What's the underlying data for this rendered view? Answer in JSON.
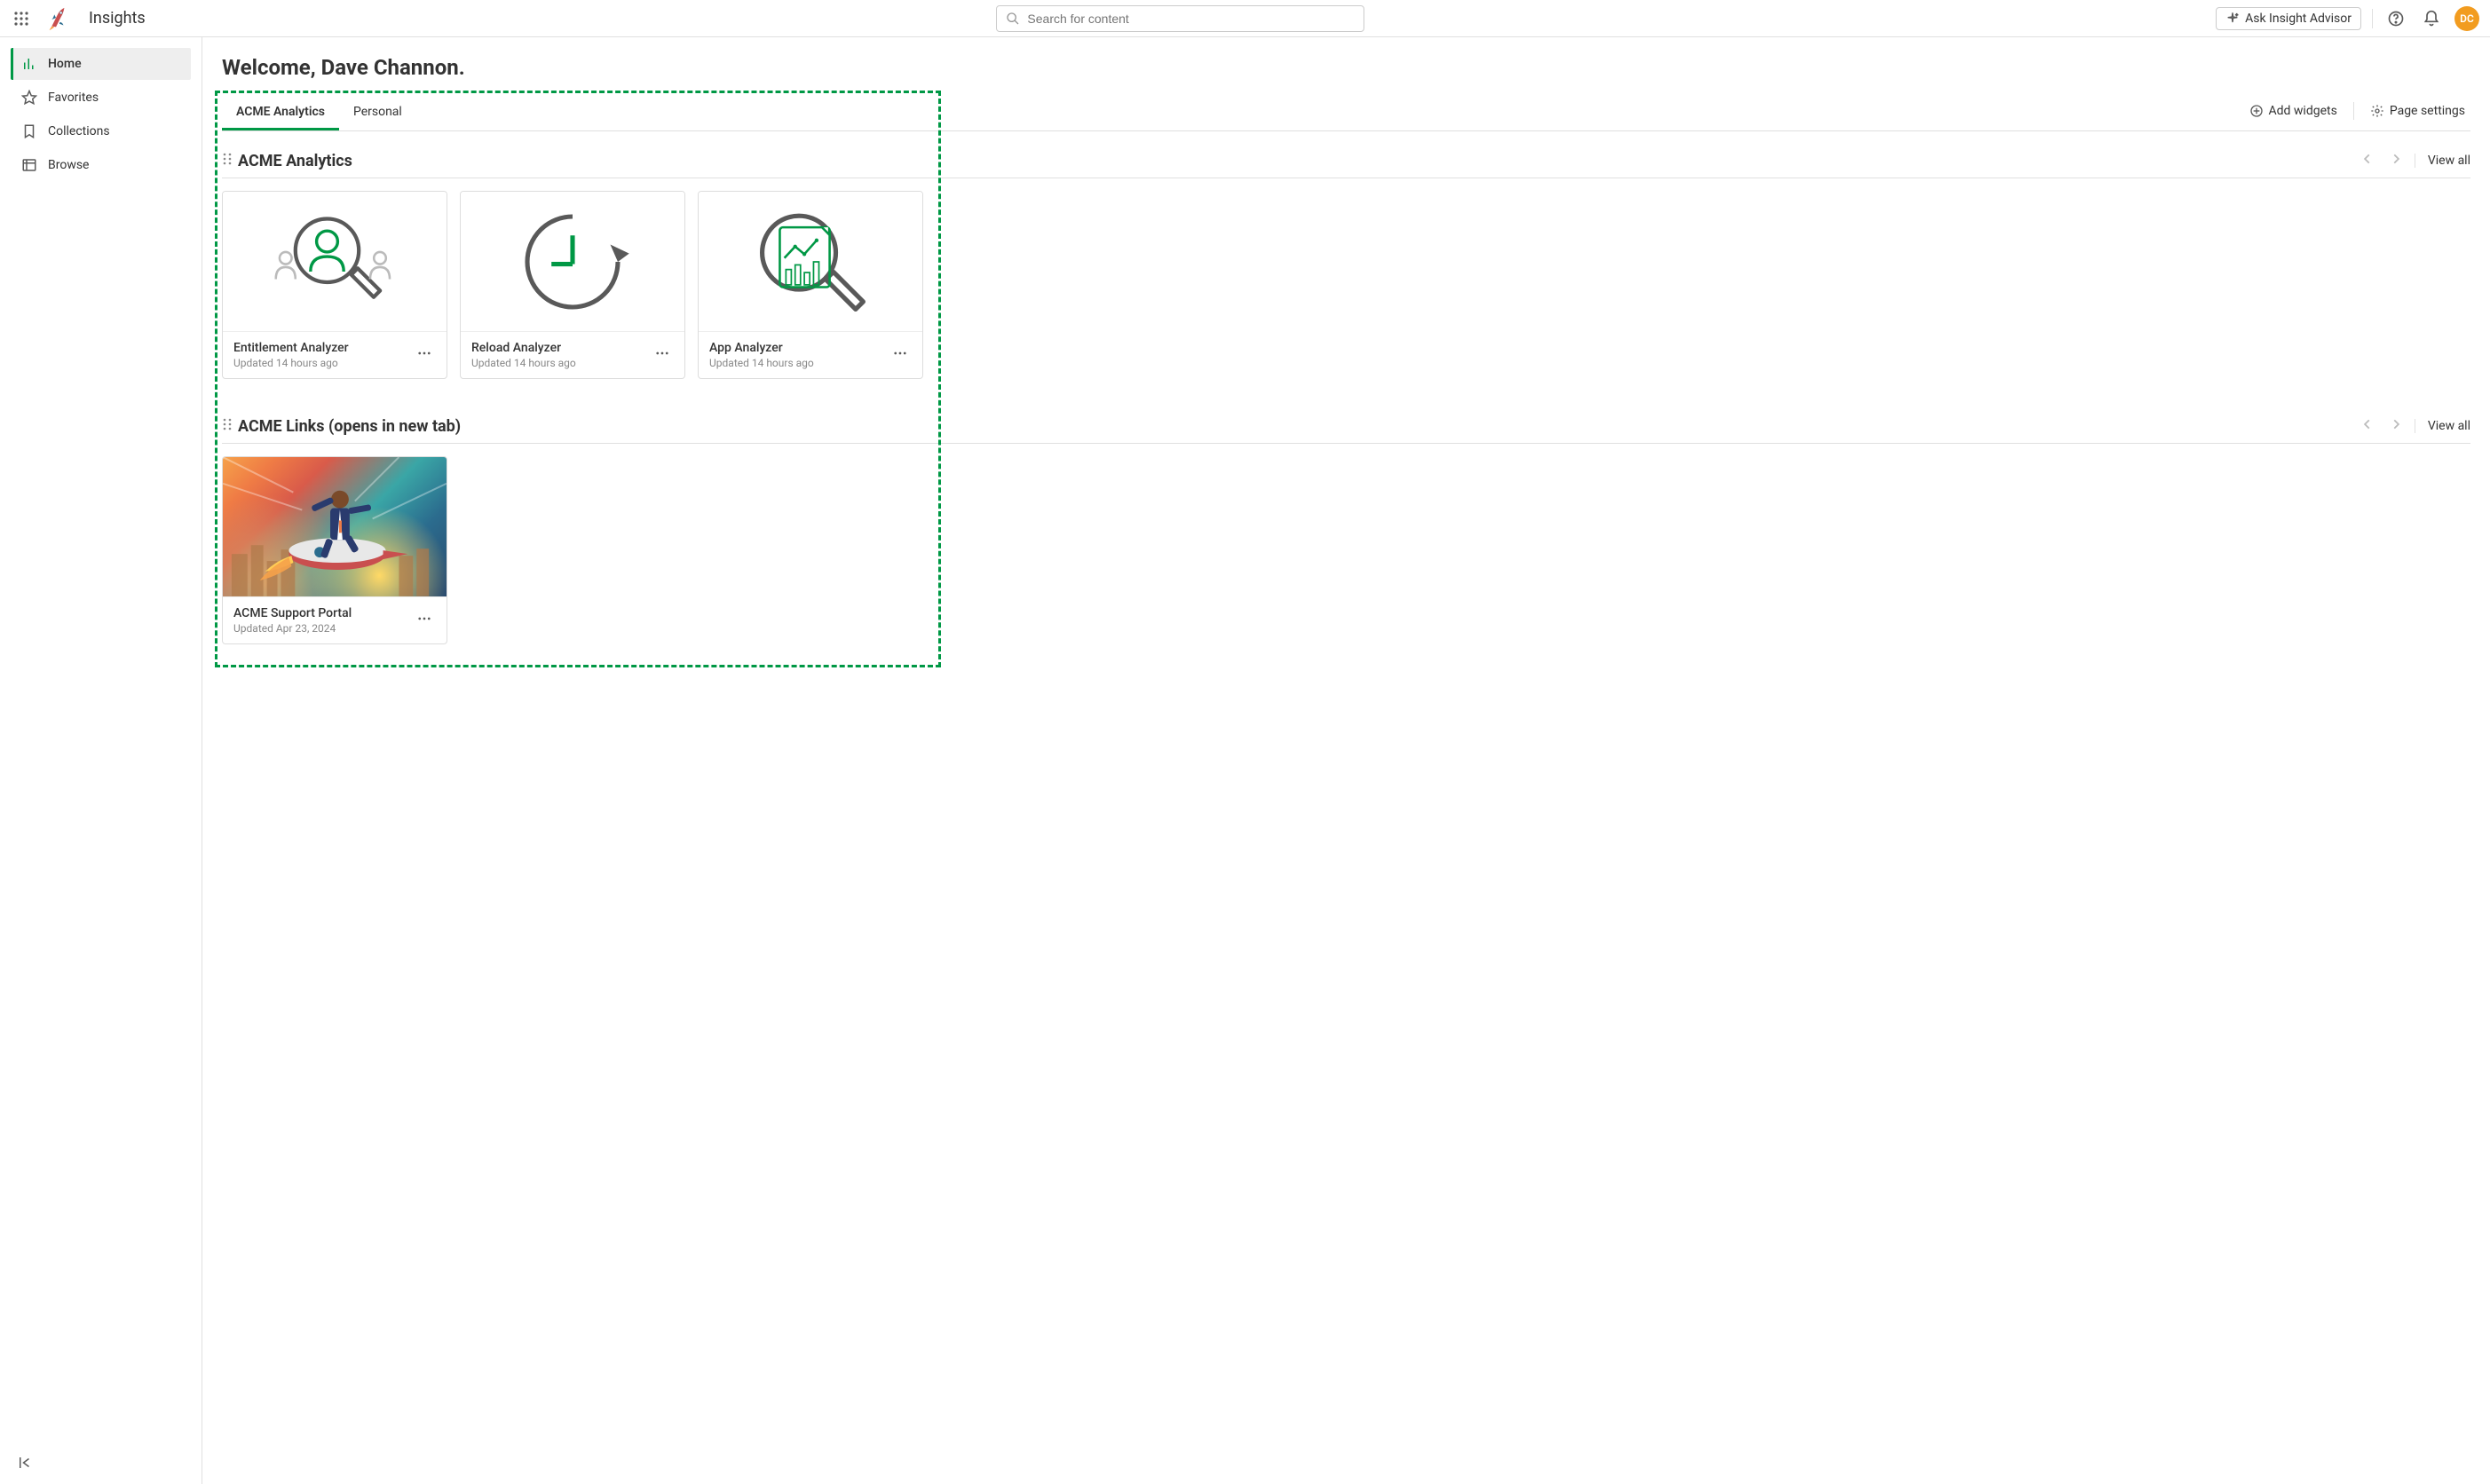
{
  "app": {
    "title": "Insights"
  },
  "search": {
    "placeholder": "Search for content"
  },
  "ask": {
    "label": "Ask Insight Advisor"
  },
  "avatar": {
    "initials": "DC"
  },
  "sidebar": {
    "items": [
      {
        "label": "Home"
      },
      {
        "label": "Favorites"
      },
      {
        "label": "Collections"
      },
      {
        "label": "Browse"
      }
    ]
  },
  "welcome": "Welcome, Dave Channon.",
  "tabs": {
    "items": [
      {
        "label": "ACME Analytics"
      },
      {
        "label": "Personal"
      }
    ]
  },
  "actions": {
    "add_widgets": "Add widgets",
    "page_settings": "Page settings"
  },
  "sections": [
    {
      "title": "ACME Analytics",
      "view_all": "View all",
      "cards": [
        {
          "title": "Entitlement Analyzer",
          "subtitle": "Updated 14 hours ago"
        },
        {
          "title": "Reload Analyzer",
          "subtitle": "Updated 14 hours ago"
        },
        {
          "title": "App Analyzer",
          "subtitle": "Updated 14 hours ago"
        }
      ]
    },
    {
      "title": "ACME Links (opens in new tab)",
      "view_all": "View all",
      "cards": [
        {
          "title": "ACME Support Portal",
          "subtitle": "Updated Apr 23, 2024"
        }
      ]
    }
  ]
}
